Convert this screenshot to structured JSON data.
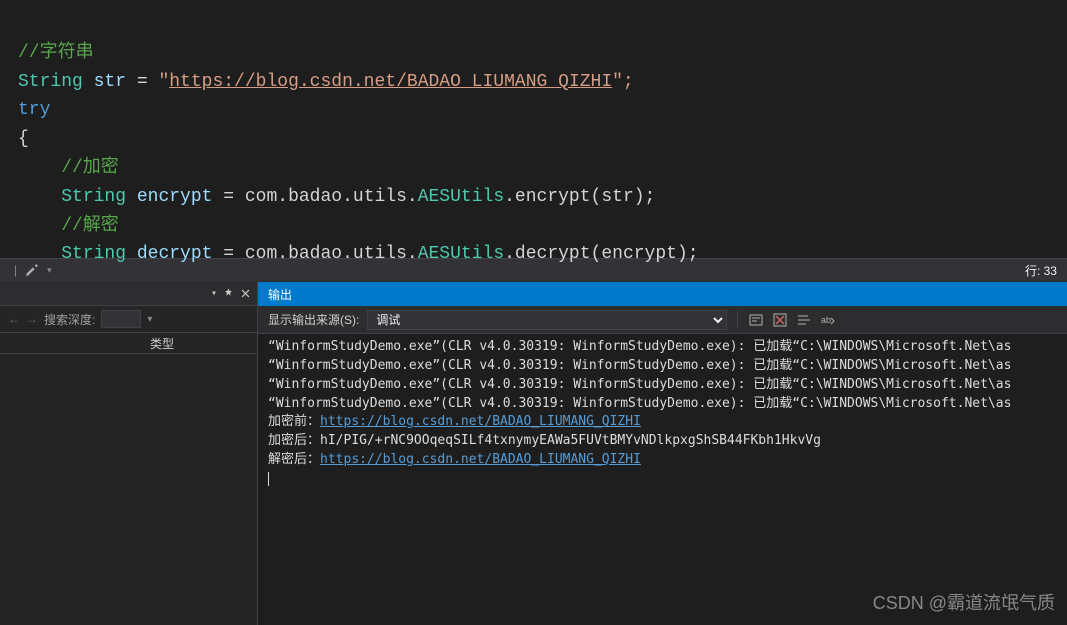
{
  "code": {
    "line1_comment": "//字符串",
    "line2_type": "String",
    "line2_var": "str",
    "line2_eq": " = ",
    "line2_strq": "\"",
    "line2_url": "https://blog.csdn.net/BADAO_LIUMANG_QIZHI",
    "line2_end": "\";",
    "line3_try": "try",
    "line4_brace": "{",
    "line5_comment": "    //加密",
    "line6_indent": "    ",
    "line6_type": "String",
    "line6_var": "encrypt",
    "line6_eq": " = ",
    "line6_expr": "com.badao.utils.",
    "line6_cls": "AESUtils",
    "line6_call": ".encrypt(str);",
    "line7_comment": "    //解密",
    "line8_indent": "    ",
    "line8_type": "String",
    "line8_var": "decrypt",
    "line8_eq": " = ",
    "line8_expr": "com.badao.utils.",
    "line8_cls": "AESUtils",
    "line8_call": ".decrypt(encrypt);"
  },
  "statusbar": {
    "pct": "…",
    "cursor": "行: 33"
  },
  "sidepanel": {
    "search_depth_label": "搜索深度:",
    "col_type": "类型"
  },
  "output": {
    "title": "输出",
    "source_label": "显示输出来源(S):",
    "source_value": "调试",
    "lines": {
      "l1": "“WinformStudyDemo.exe”(CLR v4.0.30319: WinformStudyDemo.exe): 已加载“C:\\WINDOWS\\Microsoft.Net\\as",
      "l2": "“WinformStudyDemo.exe”(CLR v4.0.30319: WinformStudyDemo.exe): 已加载“C:\\WINDOWS\\Microsoft.Net\\as",
      "l3": "“WinformStudyDemo.exe”(CLR v4.0.30319: WinformStudyDemo.exe): 已加载“C:\\WINDOWS\\Microsoft.Net\\as",
      "l4": "“WinformStudyDemo.exe”(CLR v4.0.30319: WinformStudyDemo.exe): 已加载“C:\\WINDOWS\\Microsoft.Net\\as",
      "before_label": "加密前：",
      "before_url": "https://blog.csdn.net/BADAO_LIUMANG_QIZHI",
      "cipher_label": "加密后：",
      "cipher_value": "hI/PIG/+rNC9OOqeqSILf4txnymyEAWa5FUVtBMYvNDlkpxgShSB44FKbh1HkvVg",
      "after_label": "解密后：",
      "after_url": "https://blog.csdn.net/BADAO_LIUMANG_QIZHI"
    }
  },
  "watermark": "CSDN @霸道流氓气质"
}
